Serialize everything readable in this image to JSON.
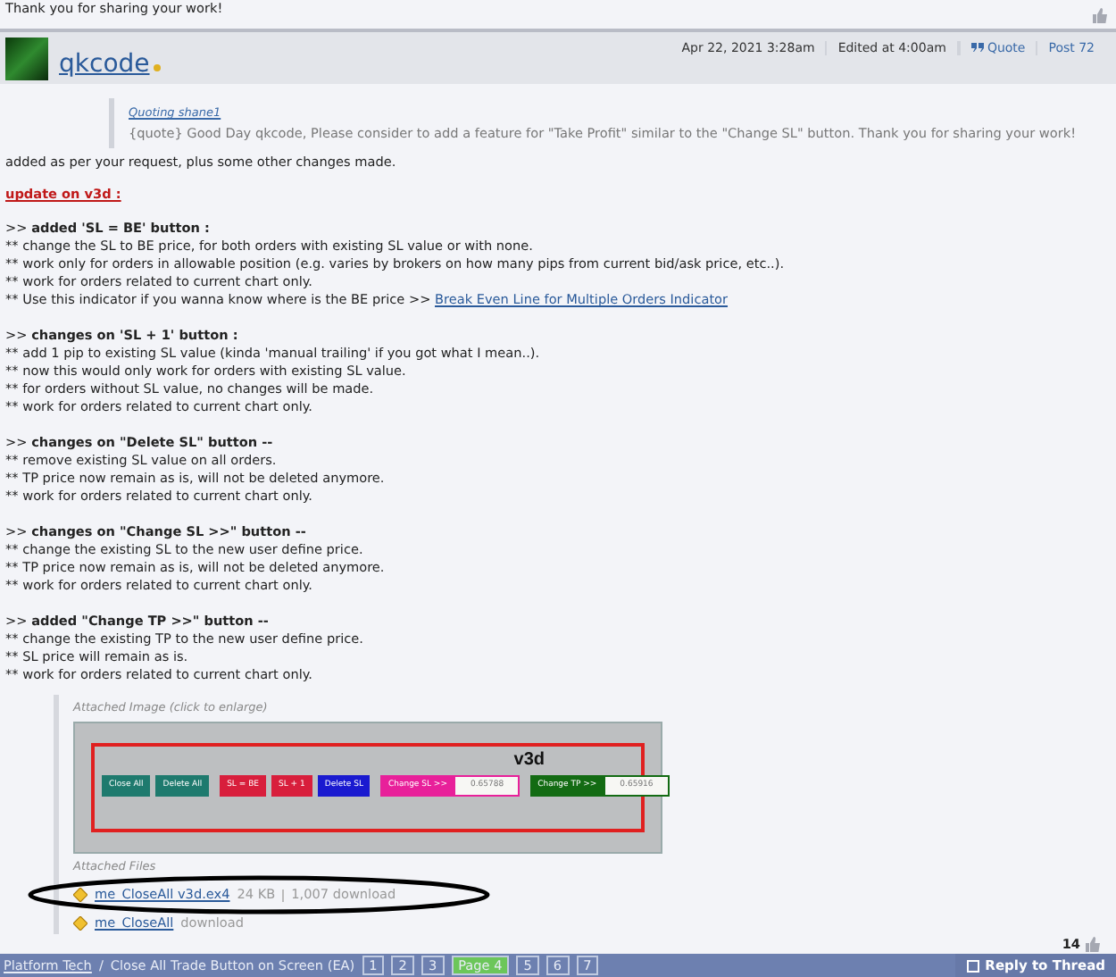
{
  "prev_post": {
    "text": "Thank you for sharing your work!"
  },
  "post": {
    "author": "qkcode",
    "date": "Apr 22, 2021 3:28am",
    "edited": "Edited at 4:00am",
    "quote_button": "Quote",
    "post_link": "Post 72",
    "quote": {
      "source": "Quoting shane1",
      "text": "{quote} Good Day qkcode, Please consider to add a feature for \"Take Profit\" similar to the \"Change SL\" button. Thank you for sharing your work!"
    },
    "intro": "added as per your request, plus some other changes made.",
    "update_heading": "update on v3d :",
    "sections": [
      {
        "heading": ">> **added 'SL = BE' button :**",
        "bullets": [
          {
            "text": "** change the SL to BE price, for both orders with existing SL value or with none."
          },
          {
            "text": "** work only for orders in allowable position (e.g. varies by brokers on how many pips from current bid/ask price, etc..)."
          },
          {
            "text": "** work for orders related to current chart only."
          },
          {
            "text": "** Use this indicator if you wanna know where is the BE price >>",
            "link": "Break Even Line for Multiple Orders Indicator"
          }
        ]
      },
      {
        "heading": ">> **changes on 'SL + 1' button :**",
        "bullets": [
          {
            "text": "** add 1 pip to existing SL value (kinda 'manual trailing' if you got what I mean..)."
          },
          {
            "text": "** now this would only work for orders with existing SL value."
          },
          {
            "text": "** for orders without SL value, no changes will be made."
          },
          {
            "text": "** work for orders related to current chart only."
          }
        ]
      },
      {
        "heading": ">> **changes on \"Delete SL\" button --**",
        "bullets": [
          {
            "text": "** remove existing SL value on all orders."
          },
          {
            "text": "** TP price now remain as is, will not be deleted anymore."
          },
          {
            "text": "** work for orders related to current chart only."
          }
        ]
      },
      {
        "heading": ">> **changes on \"Change SL >>\" button --**",
        "bullets": [
          {
            "text": "** change the existing SL to the new user define price."
          },
          {
            "text": "** TP price now remain as is, will not be deleted anymore."
          },
          {
            "text": "** work for orders related to current chart only."
          }
        ]
      },
      {
        "heading": ">> **added \"Change TP >>\" button --**",
        "bullets": [
          {
            "text": "** change the existing TP to the new user define price."
          },
          {
            "text": "** SL price will remain as is."
          },
          {
            "text": "** work for orders related to current chart only."
          }
        ]
      }
    ],
    "attached_image": {
      "label": "Attached Image (click to enlarge)",
      "title": "v3d",
      "controls": [
        {
          "kind": "button",
          "label": "Close All",
          "color": "#1e7a6e"
        },
        {
          "kind": "button",
          "label": "Delete All",
          "color": "#1e7a6e"
        },
        {
          "kind": "gap"
        },
        {
          "kind": "button",
          "label": "SL = BE",
          "color": "#d81e3c"
        },
        {
          "kind": "button",
          "label": "SL + 1",
          "color": "#d81e3c"
        },
        {
          "kind": "button",
          "label": "Delete SL",
          "color": "#1a1ad0"
        },
        {
          "kind": "gap"
        },
        {
          "kind": "button",
          "label": "Change SL >>",
          "color": "#e8209a"
        },
        {
          "kind": "field",
          "value": "0.65788",
          "color": "#e8209a"
        },
        {
          "kind": "gap"
        },
        {
          "kind": "button",
          "label": "Change TP >>",
          "color": "#136b13"
        },
        {
          "kind": "field",
          "value": "0.65916",
          "color": "#136b13"
        }
      ]
    },
    "attached_files": {
      "label": "Attached Files",
      "files": [
        {
          "name": "me_CloseAll v3d.ex4",
          "size": "24 KB",
          "downloads": "1,007 download"
        },
        {
          "name": "me_CloseAll",
          "downloads": "download"
        }
      ]
    },
    "likes": "14"
  },
  "footer": {
    "breadcrumb_link": "Platform Tech",
    "separator": "/",
    "thread_title": "Close All Trade Button on Screen (EA)",
    "pages": [
      {
        "label": "1",
        "selected": false
      },
      {
        "label": "2",
        "selected": false
      },
      {
        "label": "3",
        "selected": false
      },
      {
        "label": "Page 4",
        "selected": true
      },
      {
        "label": "5",
        "selected": false
      },
      {
        "label": "6",
        "selected": false
      },
      {
        "label": "7",
        "selected": false
      }
    ],
    "reply_button": "Reply to Thread"
  }
}
